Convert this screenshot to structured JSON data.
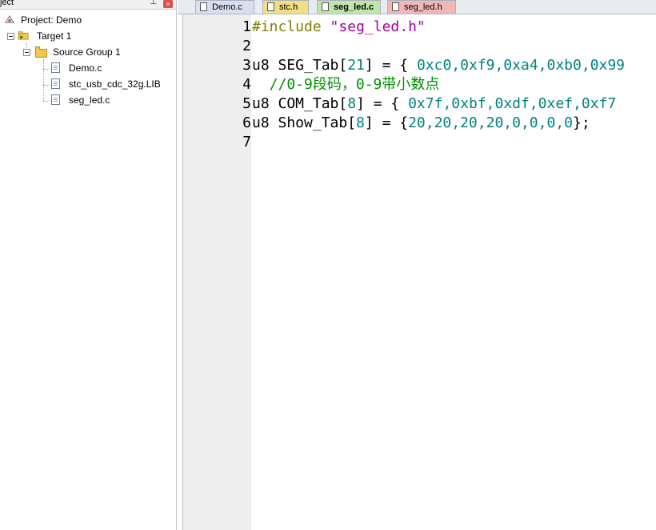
{
  "project_panel": {
    "title": "ject",
    "pin": "⊥",
    "close": "×",
    "tree": {
      "project": "Project: Demo",
      "target": "Target 1",
      "group": "Source Group 1",
      "files": [
        "Demo.c",
        "stc_usb_cdc_32g.LIB",
        "seg_led.c"
      ]
    }
  },
  "tabs": [
    {
      "label": "Demo.c",
      "color": "#d8e0f0"
    },
    {
      "label": "stc.h",
      "color": "#f3df80"
    },
    {
      "label": "seg_led.c",
      "color": "#bfe6a8",
      "active": true
    },
    {
      "label": "seg_led.h",
      "color": "#f2b6b6"
    }
  ],
  "editor": {
    "line_numbers": [
      "1",
      "2",
      "3",
      "4",
      "5",
      "6",
      "7"
    ],
    "lines": {
      "l1": {
        "directive": "#include",
        "string": "\"seg_led.h\""
      },
      "l3": {
        "a": "u8 SEG_Tab[",
        "n": "21",
        "b": "] = { ",
        "vals": "0xc0,0xf9,0xa4,0xb0,0x99"
      },
      "l4": {
        "comment": "  //0-9段码，0-9带小数点"
      },
      "l5": {
        "a": "u8 COM_Tab[",
        "n": "8",
        "b": "] = { ",
        "vals": "0x7f,0xbf,0xdf,0xef,0xf7"
      },
      "l6": {
        "a": "u8 Show_Tab[",
        "n": "8",
        "b": "] = {",
        "vals": "20,20,20,20,0,0,0,0",
        "c": "};"
      }
    }
  },
  "colors": {
    "preprocessor": "#808000",
    "string": "#a000a0",
    "number": "#008080",
    "comment": "#009000",
    "gutter": "#eeeeee"
  }
}
